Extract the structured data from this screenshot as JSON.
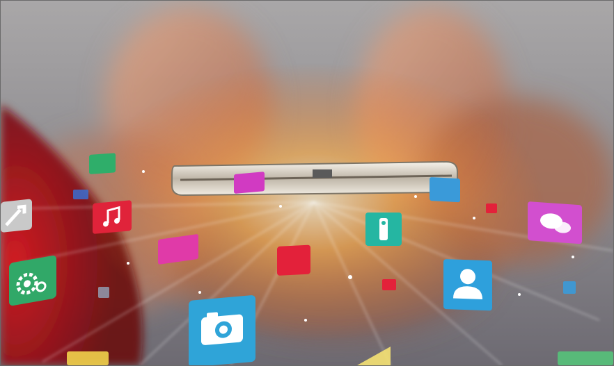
{
  "image": {
    "subject": "",
    "tiles": [
      {
        "name": "tool-app-icon",
        "color": "#c9c9c9",
        "glyph": "wrench"
      },
      {
        "name": "music-app-icon",
        "color": "#e0233a",
        "glyph": "music"
      },
      {
        "name": "settings-app-icon",
        "color": "#31a868",
        "glyph": "gear"
      },
      {
        "name": "camera-app-icon",
        "color": "#2fa4d8",
        "glyph": "camera"
      },
      {
        "name": "contacts-app-icon",
        "color": "#2ea0dc",
        "glyph": "person"
      },
      {
        "name": "chat-app-icon",
        "color": "#d24fcf",
        "glyph": "chat"
      },
      {
        "name": "remote-app-icon",
        "color": "#25b6a2",
        "glyph": "remote"
      },
      {
        "name": "green-tile-icon",
        "color": "#2fae6a",
        "glyph": "none"
      },
      {
        "name": "magenta-tile-icon",
        "color": "#e03aa8",
        "glyph": "none"
      },
      {
        "name": "red-tile-icon",
        "color": "#e3213a",
        "glyph": "none"
      },
      {
        "name": "blue-tile-icon",
        "color": "#3a9ad9",
        "glyph": "none"
      },
      {
        "name": "yellow-tile-icon",
        "color": "#f1d24b",
        "glyph": "none"
      }
    ],
    "palette": {
      "background": "#8f8f95",
      "glow": "#ff7a1a",
      "red_sleeve": "#b3121a",
      "skin": "#c98a6e",
      "phone": "#d8d2c7"
    }
  }
}
